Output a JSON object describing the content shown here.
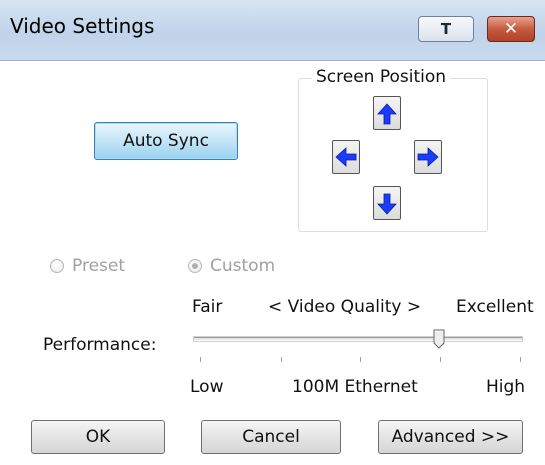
{
  "window": {
    "title": "Video Settings",
    "pin_button": "T",
    "close_button": "✕"
  },
  "auto_sync": {
    "label": "Auto Sync"
  },
  "screen_position": {
    "label": "Screen Position",
    "buttons": [
      "up-arrow-icon",
      "left-arrow-icon",
      "right-arrow-icon",
      "down-arrow-icon"
    ],
    "arrow_color": "#1a3cff"
  },
  "mode": {
    "options": [
      {
        "label": "Preset",
        "checked": false
      },
      {
        "label": "Custom",
        "checked": true
      }
    ],
    "enabled": false
  },
  "performance": {
    "label": "Performance:",
    "top_labels": {
      "left": "Fair",
      "center": "< Video Quality >",
      "right": "Excellent"
    },
    "bottom_labels": {
      "left": "Low",
      "center": "100M Ethernet",
      "right": "High"
    },
    "slider_value_fraction": 0.74,
    "tick_count": 5
  },
  "buttons": {
    "ok": "OK",
    "cancel": "Cancel",
    "advanced": "Advanced >>"
  },
  "colors": {
    "titlebar": "#c9dbee",
    "close_button": "#c75a40",
    "focus_button": "#98d1ef",
    "disabled_text": "#a0a0a0"
  }
}
